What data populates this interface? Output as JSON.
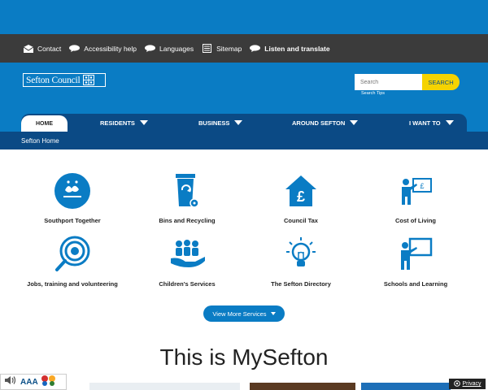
{
  "utility_bar": {
    "items": [
      {
        "label": "Contact",
        "icon": "envelope-icon"
      },
      {
        "label": "Accessibility help",
        "icon": "speech-bubble-icon"
      },
      {
        "label": "Languages",
        "icon": "speech-bubble-icon"
      },
      {
        "label": "Sitemap",
        "icon": "sitemap-icon"
      },
      {
        "label": "Listen and translate",
        "icon": "speech-bubble-icon"
      }
    ]
  },
  "header": {
    "logo_text": "Sefton Council",
    "search": {
      "placeholder": "Search",
      "button_label": "SEARCH",
      "tips_label": "Search Tips"
    }
  },
  "nav": {
    "home": "HOME",
    "items": [
      "RESIDENTS",
      "BUSINESS",
      "AROUND SEFTON",
      "I WANT TO"
    ]
  },
  "breadcrumb": "Sefton Home",
  "services": [
    {
      "label": "Southport Together",
      "icon": "southport-together-logo-icon"
    },
    {
      "label": "Bins and Recycling",
      "icon": "wheelie-bin-icon"
    },
    {
      "label": "Council Tax",
      "icon": "house-pound-icon"
    },
    {
      "label": "Cost of Living",
      "icon": "presenter-pound-board-icon"
    },
    {
      "label": "Jobs, training and volunteering",
      "icon": "magnifier-target-icon"
    },
    {
      "label": "Children's Services",
      "icon": "people-hand-icon"
    },
    {
      "label": "The Sefton Directory",
      "icon": "lightbulb-icon"
    },
    {
      "label": "Schools and Learning",
      "icon": "teacher-board-icon"
    }
  ],
  "view_more": "View More Services",
  "headline": "This is MySefton",
  "footer_widgets": {
    "text_size": "AAA",
    "privacy": "Privacy"
  },
  "colors": {
    "brand_blue": "#0a7cc4",
    "nav_dark": "#0b4a85",
    "utility_dark": "#3b3b3b",
    "search_yellow": "#f5d300"
  }
}
